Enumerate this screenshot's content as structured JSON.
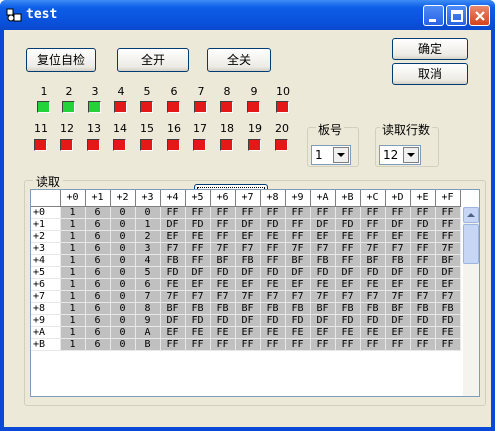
{
  "window": {
    "title": "test"
  },
  "buttons": {
    "self_check": "复位自检",
    "all_on": "全开",
    "all_off": "全关",
    "ok": "确定",
    "cancel": "取消",
    "read": "读取"
  },
  "channels": [
    {
      "n": "1",
      "state": "on"
    },
    {
      "n": "2",
      "state": "on"
    },
    {
      "n": "3",
      "state": "on"
    },
    {
      "n": "4",
      "state": "off"
    },
    {
      "n": "5",
      "state": "off"
    },
    {
      "n": "6",
      "state": "off"
    },
    {
      "n": "7",
      "state": "off"
    },
    {
      "n": "8",
      "state": "off"
    },
    {
      "n": "9",
      "state": "off"
    },
    {
      "n": "10",
      "state": "off"
    },
    {
      "n": "11",
      "state": "off"
    },
    {
      "n": "12",
      "state": "off"
    },
    {
      "n": "13",
      "state": "off"
    },
    {
      "n": "14",
      "state": "off"
    },
    {
      "n": "15",
      "state": "off"
    },
    {
      "n": "16",
      "state": "off"
    },
    {
      "n": "17",
      "state": "off"
    },
    {
      "n": "18",
      "state": "off"
    },
    {
      "n": "19",
      "state": "off"
    },
    {
      "n": "20",
      "state": "off"
    }
  ],
  "board": {
    "label": "板号",
    "value": "1"
  },
  "rows_to_read": {
    "label": "读取行数",
    "value": "12"
  },
  "read_group": {
    "label": "读取"
  },
  "colors": {
    "on": "#22d33a",
    "off": "#e51818"
  },
  "table": {
    "headers": [
      "",
      "+0",
      "+1",
      "+2",
      "+3",
      "+4",
      "+5",
      "+6",
      "+7",
      "+8",
      "+9",
      "+A",
      "+B",
      "+C",
      "+D",
      "+E",
      "+F"
    ],
    "rows": [
      [
        "+0",
        "1",
        "6",
        "0",
        "0",
        "FF",
        "FF",
        "FF",
        "FF",
        "FF",
        "FF",
        "FF",
        "FF",
        "FF",
        "FF",
        "FF",
        "FF"
      ],
      [
        "+1",
        "1",
        "6",
        "0",
        "1",
        "DF",
        "FD",
        "FF",
        "DF",
        "FD",
        "FF",
        "DF",
        "FD",
        "FF",
        "DF",
        "FD",
        "FF"
      ],
      [
        "+2",
        "1",
        "6",
        "0",
        "2",
        "EF",
        "FE",
        "FF",
        "EF",
        "FE",
        "FF",
        "EF",
        "FE",
        "FF",
        "EF",
        "FE",
        "FF"
      ],
      [
        "+3",
        "1",
        "6",
        "0",
        "3",
        "F7",
        "FF",
        "7F",
        "F7",
        "FF",
        "7F",
        "F7",
        "FF",
        "7F",
        "F7",
        "FF",
        "7F"
      ],
      [
        "+4",
        "1",
        "6",
        "0",
        "4",
        "FB",
        "FF",
        "BF",
        "FB",
        "FF",
        "BF",
        "FB",
        "FF",
        "BF",
        "FB",
        "FF",
        "BF"
      ],
      [
        "+5",
        "1",
        "6",
        "0",
        "5",
        "FD",
        "DF",
        "FD",
        "DF",
        "FD",
        "DF",
        "FD",
        "DF",
        "FD",
        "DF",
        "FD",
        "DF"
      ],
      [
        "+6",
        "1",
        "6",
        "0",
        "6",
        "FE",
        "EF",
        "FE",
        "EF",
        "FE",
        "EF",
        "FE",
        "EF",
        "FE",
        "EF",
        "FE",
        "EF"
      ],
      [
        "+7",
        "1",
        "6",
        "0",
        "7",
        "7F",
        "F7",
        "F7",
        "7F",
        "F7",
        "F7",
        "7F",
        "F7",
        "F7",
        "7F",
        "F7",
        "F7"
      ],
      [
        "+8",
        "1",
        "6",
        "0",
        "8",
        "BF",
        "FB",
        "FB",
        "BF",
        "FB",
        "FB",
        "BF",
        "FB",
        "FB",
        "BF",
        "FB",
        "FB"
      ],
      [
        "+9",
        "1",
        "6",
        "0",
        "9",
        "DF",
        "FD",
        "FD",
        "DF",
        "FD",
        "FD",
        "DF",
        "FD",
        "FD",
        "DF",
        "FD",
        "FD"
      ],
      [
        "+A",
        "1",
        "6",
        "0",
        "A",
        "EF",
        "FE",
        "FE",
        "EF",
        "FE",
        "FE",
        "EF",
        "FE",
        "FE",
        "EF",
        "FE",
        "FE"
      ],
      [
        "+B",
        "1",
        "6",
        "0",
        "B",
        "FF",
        "FF",
        "FF",
        "FF",
        "FF",
        "FF",
        "FF",
        "FF",
        "FF",
        "FF",
        "FF",
        "FF"
      ]
    ]
  }
}
